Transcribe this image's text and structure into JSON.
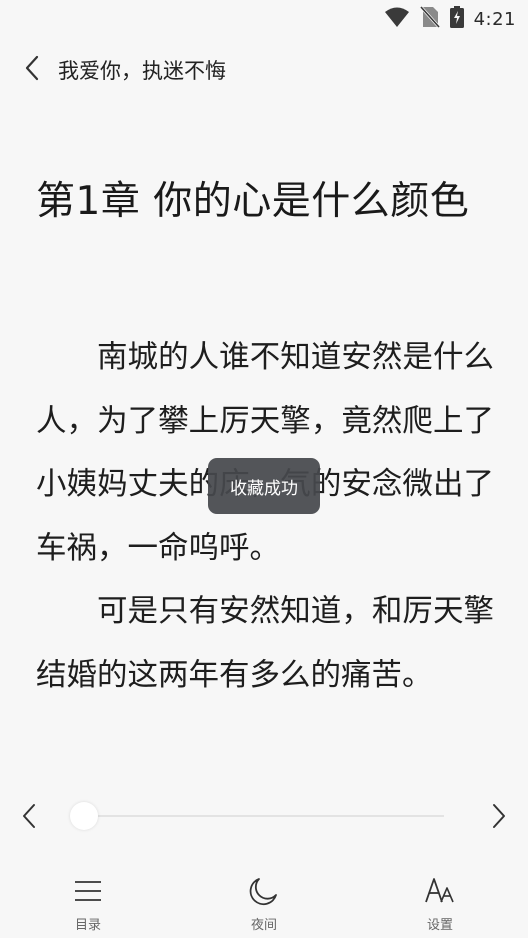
{
  "status_bar": {
    "time": "4:21"
  },
  "header": {
    "book_title": "我爱你，执迷不悔"
  },
  "chapter": {
    "title": "第1章 你的心是什么颜色"
  },
  "content": {
    "paragraphs": [
      "南城的人谁不知道安然是什么人，为了攀上厉天擎，竟然爬上了小姨妈丈夫的床，气的安念微出了车祸，一命呜呼。",
      "可是只有安然知道，和厉天擎结婚的这两年有多么的痛苦。"
    ]
  },
  "toast": {
    "text": "收藏成功"
  },
  "progress": {
    "fraction": 0.0
  },
  "bottom_nav": {
    "catalog_label": "目录",
    "night_label": "夜间",
    "settings_label": "设置"
  }
}
